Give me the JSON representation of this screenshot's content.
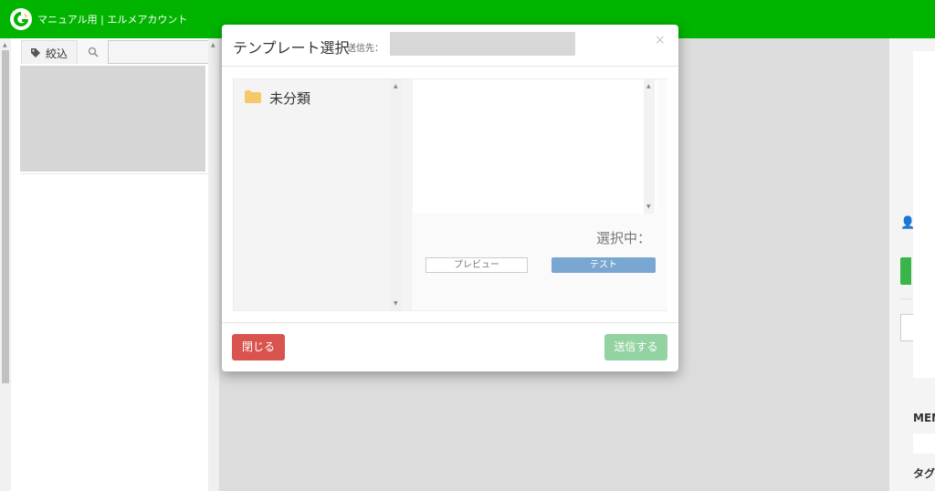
{
  "header": {
    "app_title": "マニュアル用 | エルメアカウント"
  },
  "left_panel": {
    "filter_tab_label": "絞込",
    "search_tab_icon": "search-icon",
    "filter_tab_icon": "tag-icon"
  },
  "right_panel": {
    "menu_label": "MEN",
    "tag_label": "タグ"
  },
  "modal": {
    "title": "テンプレート選択",
    "recipient_label": "送信先：",
    "close_icon": "×",
    "folders": [
      {
        "label": "未分類",
        "icon": "folder-icon"
      }
    ],
    "selected_label": "選択中：",
    "preview_button": "プレビュー",
    "test_button": "テスト",
    "close_button": "閉じる",
    "send_button": "送信する"
  },
  "colors": {
    "header_green": "#00b400",
    "close_red": "#d9534f",
    "send_green_disabled": "#93d3a2",
    "test_blue": "#7aa7d1"
  }
}
